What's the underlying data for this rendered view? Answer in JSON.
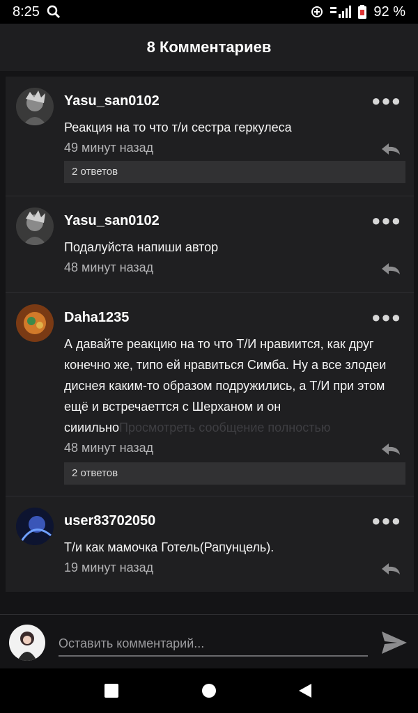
{
  "status": {
    "time": "8:25",
    "battery": "92 %"
  },
  "header": {
    "title": "8 Комментариев"
  },
  "comments": [
    {
      "author": "Yasu_san0102",
      "text": "Реакция на то что т/и сестра геркулеса",
      "time": "49 минут назад",
      "replies": "2 ответов"
    },
    {
      "author": "Yasu_san0102",
      "text": "Подалуйста напиши автор",
      "time": "48 минут назад"
    },
    {
      "author": "Daha1235",
      "text": "А давайте реакцию на то что Т/И нравиится, как друг конечно же, типо ей нравиться Симба. Ну а все злодеи диснея каким-то образом подружились, а Т/И при этом ещё и встречаеттся с Шерханом и он сииильно",
      "more": "Просмотреть сообщение полностью",
      "time": "48 минут назад",
      "replies": "2 ответов"
    },
    {
      "author": "user83702050",
      "text": "Т/и как мамочка Готель(Рапунцель).",
      "time": "19 минут назад"
    }
  ],
  "compose": {
    "placeholder": "Оставить комментарий..."
  },
  "colors": {
    "background": "#141416",
    "card": "#1f1f21",
    "accent": "#ffffff"
  },
  "icons": [
    "search-icon",
    "data-saver-icon",
    "signal-icon",
    "battery-icon",
    "more-icon",
    "reply-icon",
    "send-icon",
    "nav-square-icon",
    "nav-circle-icon",
    "nav-back-icon"
  ]
}
